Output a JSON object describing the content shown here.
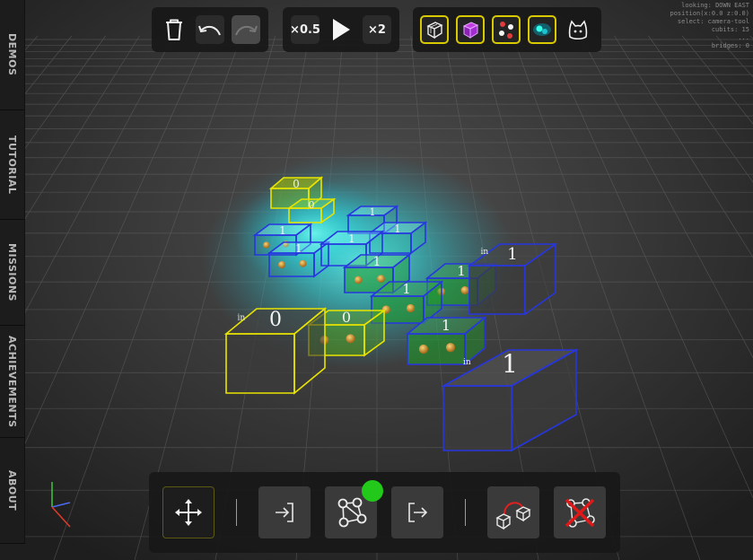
{
  "sidebar": {
    "tabs": [
      {
        "id": "demos",
        "label": "DEMOS"
      },
      {
        "id": "tutorial",
        "label": "TUTORIAL"
      },
      {
        "id": "missions",
        "label": "MISSIONS"
      },
      {
        "id": "achievements",
        "label": "ACHIEVEMENTS"
      },
      {
        "id": "about",
        "label": "ABOUT"
      }
    ]
  },
  "toolbar_top": {
    "history": [
      {
        "id": "trash",
        "icon": "trash-icon"
      },
      {
        "id": "undo",
        "icon": "undo-arrow-icon"
      },
      {
        "id": "redo",
        "icon": "redo-arrow-icon"
      }
    ],
    "speed": {
      "slower_label": "×0.5",
      "play_icon": "play-icon",
      "faster_label": "×2"
    },
    "view_modes": [
      {
        "id": "wire-cube",
        "icon": "wireframe-cube-icon",
        "selected": true
      },
      {
        "id": "purple-cube",
        "icon": "purple-cube-icon",
        "selected": true
      },
      {
        "id": "particles",
        "icon": "particles-icon",
        "selected": true
      },
      {
        "id": "glow",
        "icon": "glow-blob-icon",
        "selected": true
      },
      {
        "id": "cat",
        "icon": "cat-icon",
        "selected": false
      }
    ]
  },
  "status_lines": [
    "looking: DOWN EAST",
    "position(x:0.0 z:0.0)",
    "select: camera-tool",
    "cubits: 15",
    "...",
    "bridges: 0"
  ],
  "toolbar_bottom": {
    "tools": [
      {
        "id": "move",
        "icon": "move-arrows-icon",
        "active": true
      },
      {
        "id": "input",
        "icon": "input-arrow-icon",
        "active": false
      },
      {
        "id": "graph",
        "icon": "graph-nodes-icon",
        "active": false,
        "badge": true
      },
      {
        "id": "output",
        "icon": "output-arrow-icon",
        "active": false
      },
      {
        "id": "bridge",
        "icon": "bridge-cubes-icon",
        "active": false
      },
      {
        "id": "delete-graph",
        "icon": "delete-graph-icon",
        "active": false
      }
    ]
  },
  "scene": {
    "cube_labels": {
      "in_0": "0",
      "in_1_small": "1",
      "in_1_big": "1",
      "in_tag": "in",
      "digits": [
        "0",
        "0",
        "1",
        "1",
        "1",
        "1",
        "1",
        "1",
        "1",
        "1",
        "1",
        "1",
        "0"
      ]
    },
    "colors": {
      "wire_blue": "#2636e0",
      "wire_yellow": "#e8e400",
      "glow_cyan": "#35fff0",
      "cell_green": "#1f9a2a",
      "ball_orange": "#d49a2c",
      "badge_green": "#22c81a"
    }
  }
}
